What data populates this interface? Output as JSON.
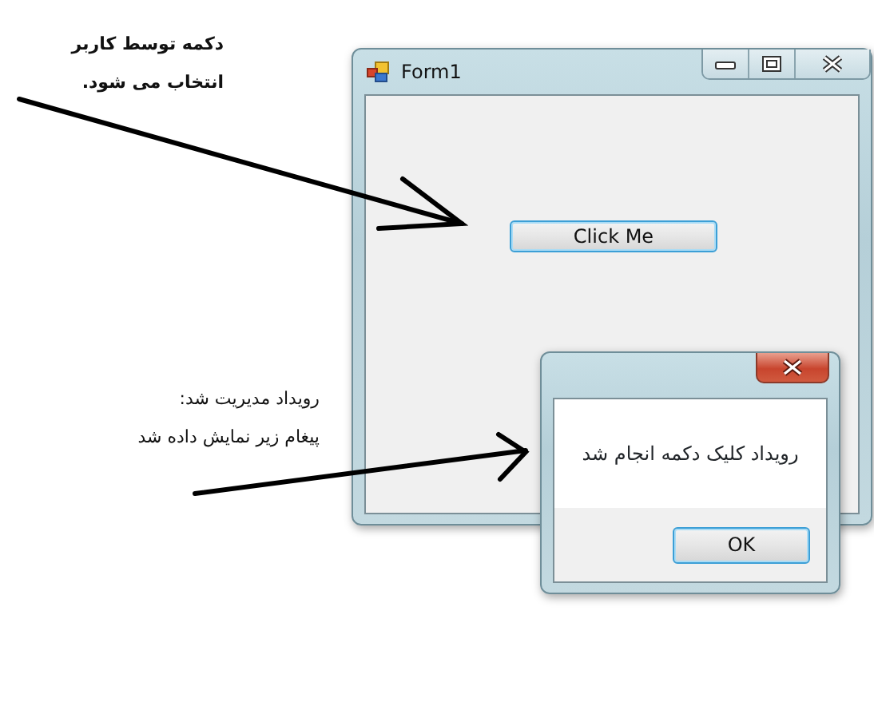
{
  "annotations": [
    {
      "text": "دکمه توسط کاربر\nانتخاب می شود.",
      "bold": true
    },
    {
      "text": "رویداد مدیریت شد:\nپیغام زیر نمایش داده شد",
      "bold": false
    }
  ],
  "form_window": {
    "title": "Form1",
    "button": {
      "label": "Click Me",
      "focused": true
    }
  },
  "message_box": {
    "message": "رویداد کلیک دکمه انجام شد",
    "button": {
      "label": "OK",
      "focused": true
    }
  }
}
